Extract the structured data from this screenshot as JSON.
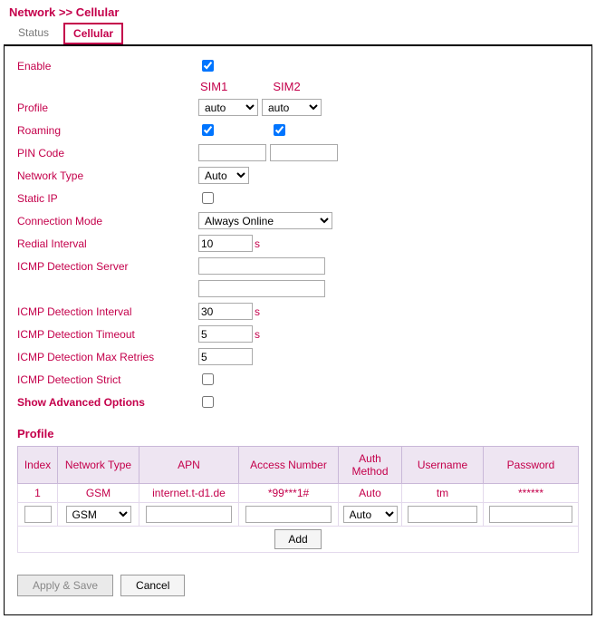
{
  "breadcrumb": "Network >> Cellular",
  "tabs": {
    "status": "Status",
    "cellular": "Cellular"
  },
  "sim_headers": {
    "sim1": "SIM1",
    "sim2": "SIM2"
  },
  "labels": {
    "enable": "Enable",
    "profile": "Profile",
    "roaming": "Roaming",
    "pin": "PIN Code",
    "nettype": "Network Type",
    "staticip": "Static IP",
    "connmode": "Connection Mode",
    "redial": "Redial Interval",
    "icmp_server": "ICMP Detection Server",
    "icmp_interval": "ICMP Detection Interval",
    "icmp_timeout": "ICMP Detection Timeout",
    "icmp_retries": "ICMP Detection Max Retries",
    "icmp_strict": "ICMP Detection Strict",
    "show_adv": "Show Advanced Options"
  },
  "values": {
    "enable": true,
    "profile_sim1": "auto",
    "profile_sim2": "auto",
    "roaming_sim1": true,
    "roaming_sim2": true,
    "pin_sim1": "",
    "pin_sim2": "",
    "nettype": "Auto",
    "staticip": false,
    "connmode": "Always Online",
    "redial": "10",
    "icmp_server1": "",
    "icmp_server2": "",
    "icmp_interval": "30",
    "icmp_timeout": "5",
    "icmp_retries": "5",
    "icmp_strict": false,
    "show_adv": false
  },
  "unit_s": "s",
  "profile_section": "Profile",
  "profile_table": {
    "headers": {
      "index": "Index",
      "nettype": "Network Type",
      "apn": "APN",
      "accessnum": "Access Number",
      "authmethod": "Auth Method",
      "username": "Username",
      "password": "Password"
    },
    "rows": [
      {
        "index": "1",
        "nettype": "GSM",
        "apn": "internet.t-d1.de",
        "accessnum": "*99***1#",
        "authmethod": "Auto",
        "username": "tm",
        "password": "******"
      }
    ],
    "new_row": {
      "nettype": "GSM",
      "authmethod": "Auto"
    },
    "add_btn": "Add"
  },
  "buttons": {
    "apply": "Apply & Save",
    "cancel": "Cancel"
  }
}
